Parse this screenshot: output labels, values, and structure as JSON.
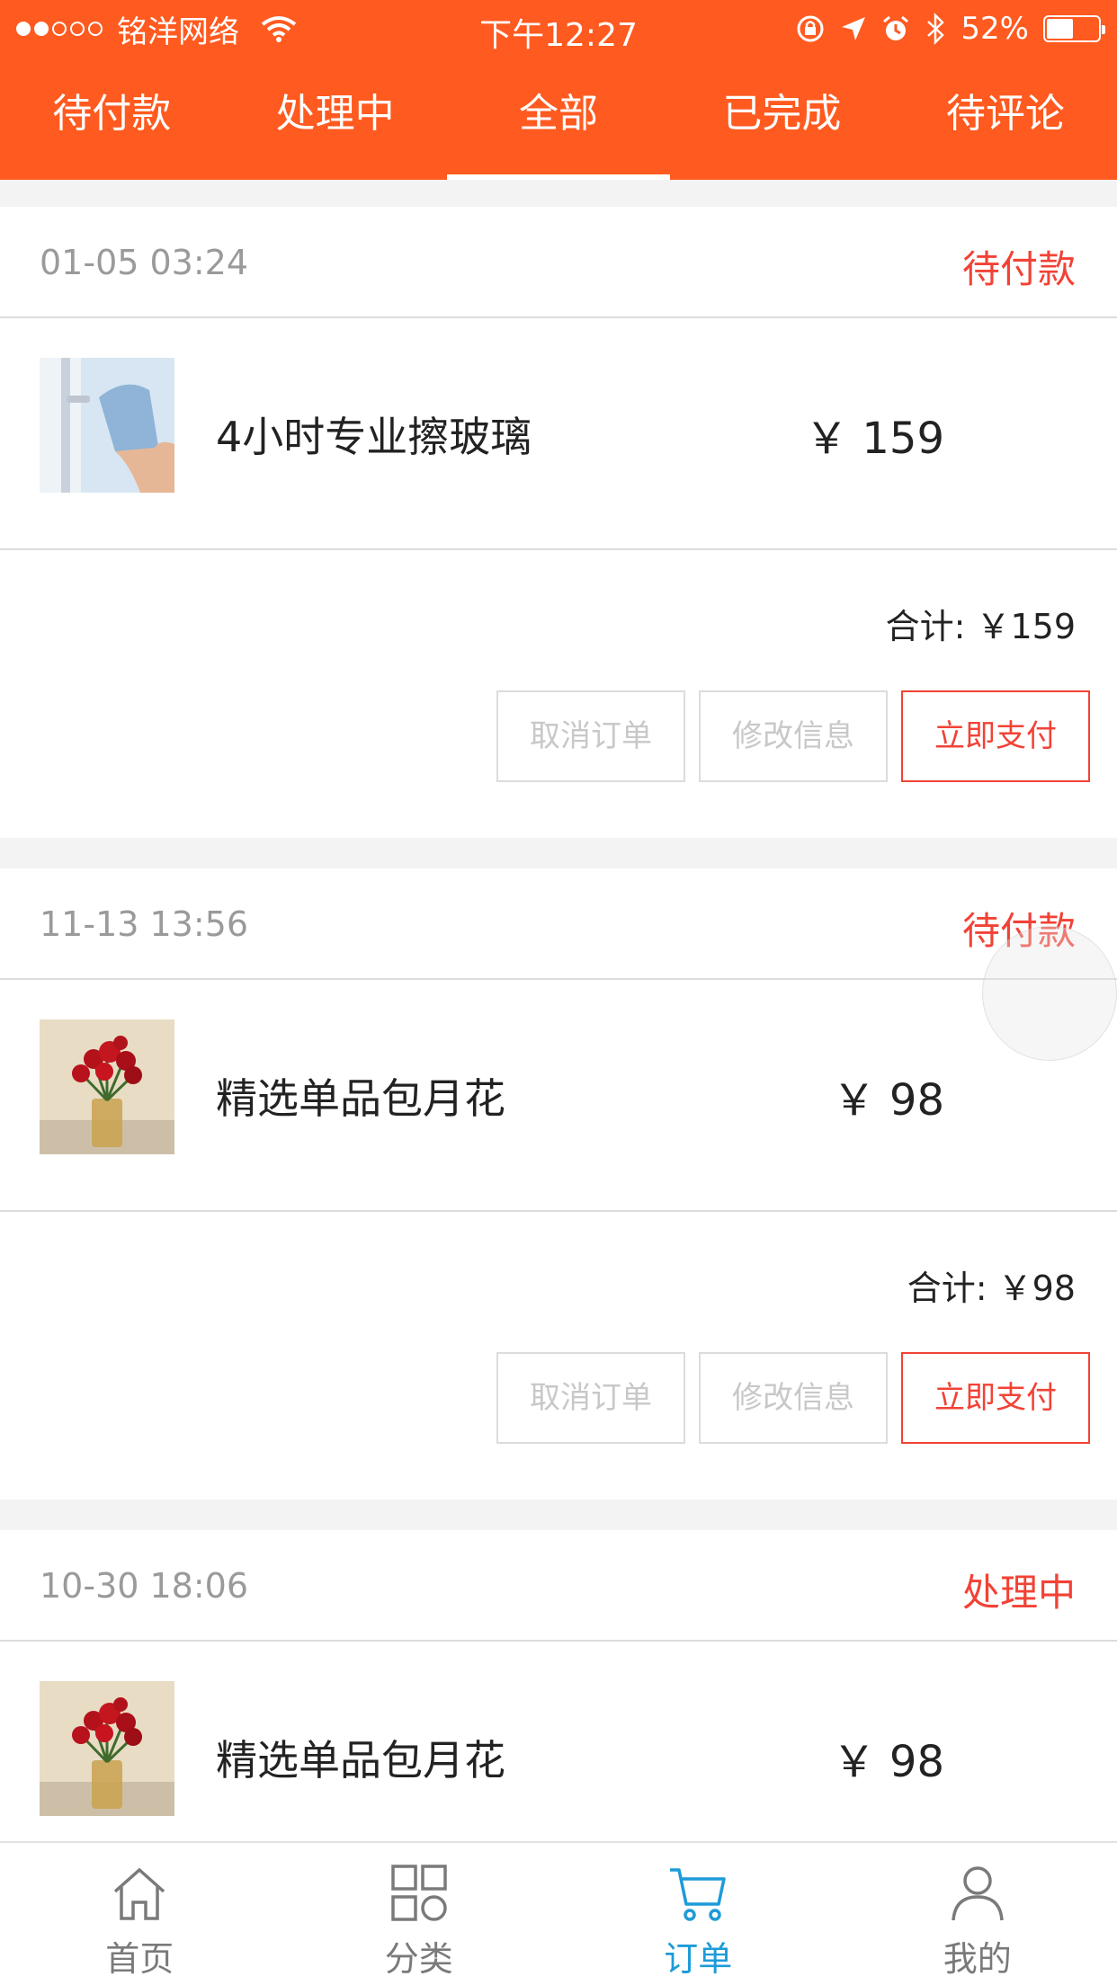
{
  "status_bar": {
    "carrier": "铭洋网络",
    "time": "下午12:27",
    "battery": "52%",
    "battery_level": 0.52
  },
  "tabs": [
    {
      "label": "待付款",
      "active": false
    },
    {
      "label": "处理中",
      "active": false
    },
    {
      "label": "全部",
      "active": true
    },
    {
      "label": "已完成",
      "active": false
    },
    {
      "label": "待评论",
      "active": false
    }
  ],
  "orders": [
    {
      "date": "01-05 03:24",
      "status": "待付款",
      "item_name": "4小时专业擦玻璃",
      "price": "￥ 159",
      "total": "合计: ￥159",
      "buttons": {
        "cancel": "取消订单",
        "modify": "修改信息",
        "pay": "立即支付"
      }
    },
    {
      "date": "11-13 13:56",
      "status": "待付款",
      "item_name": "精选单品包月花",
      "price": "￥ 98",
      "total": "合计: ￥98",
      "buttons": {
        "cancel": "取消订单",
        "modify": "修改信息",
        "pay": "立即支付"
      }
    },
    {
      "date": "10-30 18:06",
      "status": "处理中",
      "item_name": "精选单品包月花",
      "price": "￥ 98"
    }
  ],
  "bottom_nav": [
    {
      "label": "首页",
      "icon": "home-icon"
    },
    {
      "label": "分类",
      "icon": "grid-icon"
    },
    {
      "label": "订单",
      "icon": "cart-icon"
    },
    {
      "label": "我的",
      "icon": "user-icon"
    }
  ],
  "colors": {
    "header": "#ff5a1f",
    "status_red": "#f24236",
    "nav_active": "#1d9bd8"
  }
}
